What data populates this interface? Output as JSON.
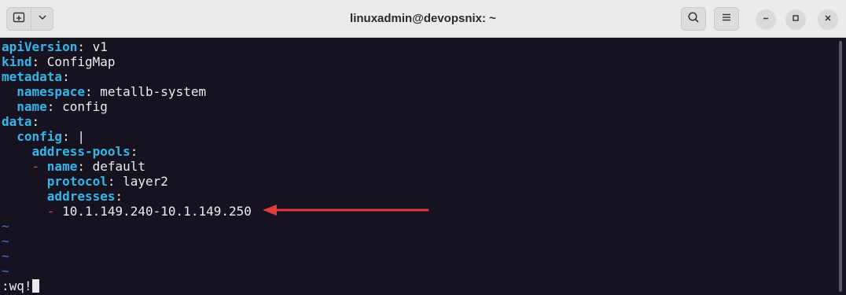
{
  "window": {
    "title": "linuxadmin@devopsnix: ~",
    "accent_color": "#33b6e8",
    "arrow_color": "#e23b3b"
  },
  "toolbar": {
    "new_tab_icon": "new-tab-icon",
    "menu_dropdown_icon": "chevron-down-icon",
    "search_icon": "search-icon",
    "hamburger_icon": "hamburger-menu-icon",
    "minimize_icon": "minimize-icon",
    "maximize_icon": "maximize-icon",
    "close_icon": "close-icon"
  },
  "editor": {
    "lines": [
      {
        "key": "apiVersion",
        "sep": ": ",
        "value": "v1"
      },
      {
        "key": "kind",
        "sep": ": ",
        "value": "ConfigMap"
      },
      {
        "key": "metadata",
        "sep": ":",
        "value": ""
      },
      {
        "indent": "  ",
        "key": "namespace",
        "sep": ": ",
        "value": "metallb-system"
      },
      {
        "indent": "  ",
        "key": "name",
        "sep": ": ",
        "value": "config"
      },
      {
        "key": "data",
        "sep": ":",
        "value": ""
      },
      {
        "indent": "  ",
        "key": "config",
        "sep": ": ",
        "value": "|"
      },
      {
        "indent": "    ",
        "key": "address-pools",
        "sep": ":",
        "value": ""
      },
      {
        "indent": "    ",
        "dash": "- ",
        "key": "name",
        "sep": ": ",
        "value": "default"
      },
      {
        "indent": "      ",
        "key": "protocol",
        "sep": ": ",
        "value": "layer2"
      },
      {
        "indent": "      ",
        "key": "addresses",
        "sep": ":",
        "value": ""
      },
      {
        "indent": "      ",
        "dash": "- ",
        "value": "10.1.149.240-10.1.149.250"
      }
    ],
    "tildes": [
      "~",
      "~",
      "~",
      "~"
    ],
    "command": ":wq!"
  }
}
